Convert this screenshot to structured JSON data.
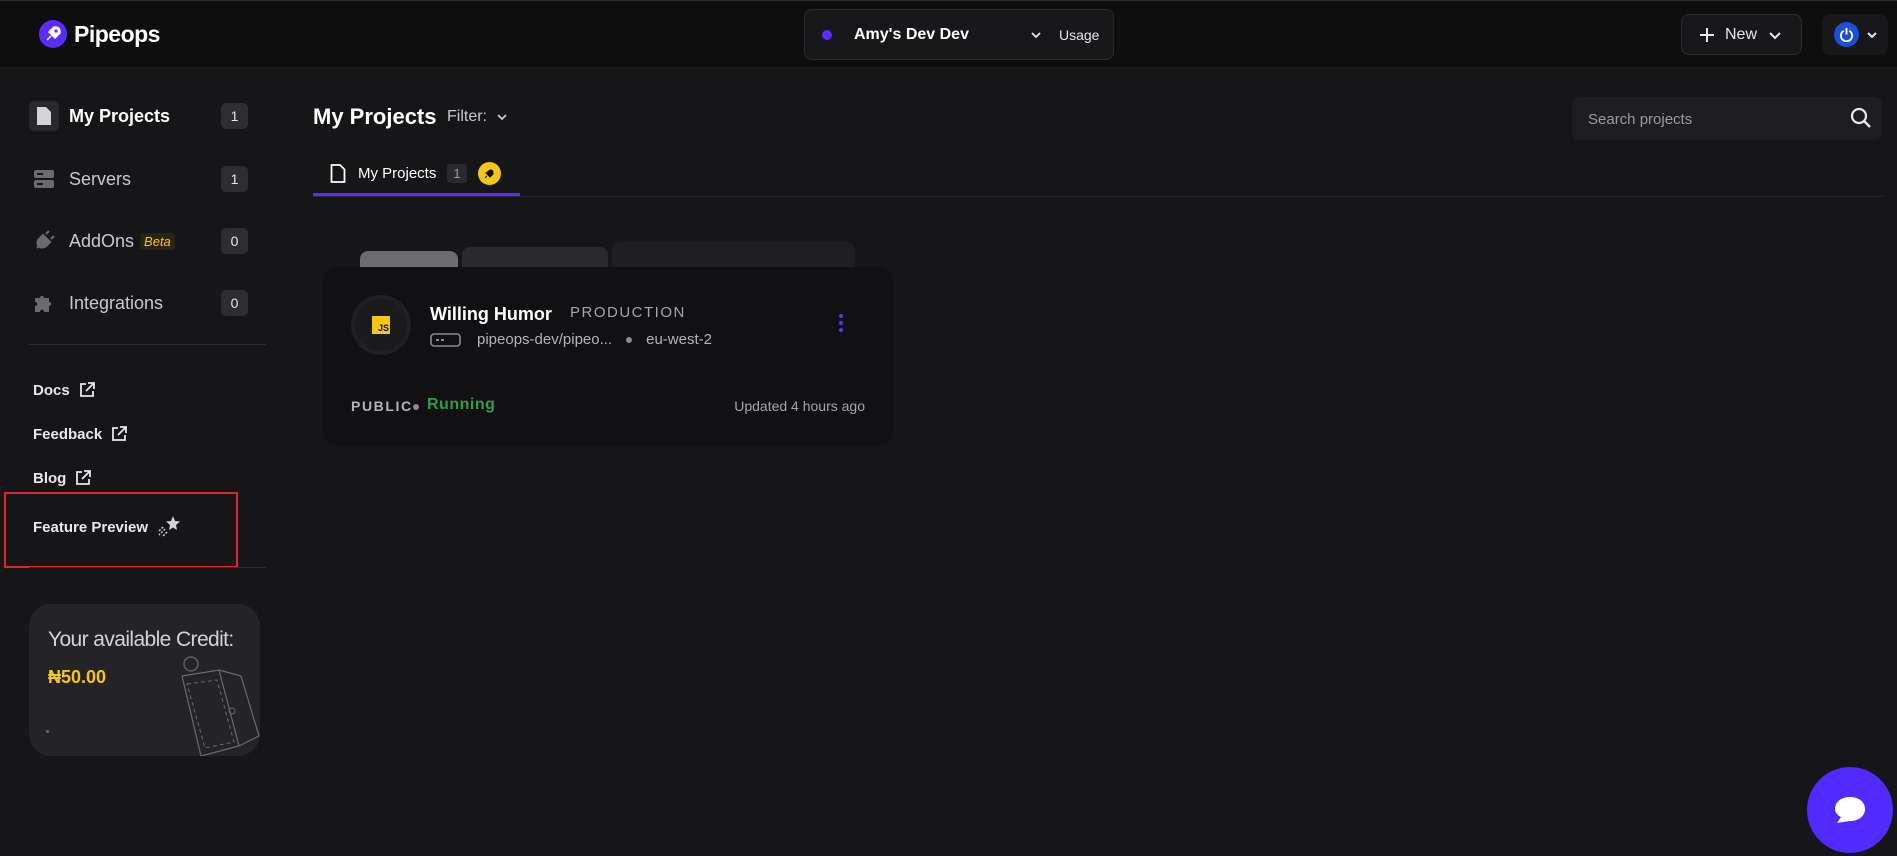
{
  "app": {
    "name": "Pipeops"
  },
  "workspace": {
    "name": "Amy's Dev Dev",
    "usage_label": "Usage"
  },
  "header": {
    "new_label": "New"
  },
  "sidebar": {
    "items": [
      {
        "label": "My Projects",
        "count": "1"
      },
      {
        "label": "Servers",
        "count": "1"
      },
      {
        "label": "AddOns",
        "badge": "Beta",
        "count": "0"
      },
      {
        "label": "Integrations",
        "count": "0"
      }
    ],
    "links": [
      {
        "label": "Docs"
      },
      {
        "label": "Feedback"
      },
      {
        "label": "Blog"
      },
      {
        "label": "Feature Preview"
      }
    ],
    "credit": {
      "title": "Your available Credit:",
      "amount": "₦50.00"
    }
  },
  "main": {
    "title": "My Projects",
    "filter_label": "Filter:",
    "search": {
      "placeholder": "Search projects"
    },
    "tab": {
      "label": "My Projects",
      "count": "1"
    },
    "projects": [
      {
        "name": "Willing Humor",
        "environment": "PRODUCTION",
        "repo": "pipeops-dev/pipeo...",
        "region": "eu-west-2",
        "visibility": "PUBLIC",
        "status": "Running",
        "updated": "Updated 4 hours ago"
      }
    ]
  },
  "colors": {
    "accent": "#5b2bff",
    "highlight": "#f5c518",
    "running": "#2e9e4a",
    "annotation_box": "#e0262b"
  }
}
